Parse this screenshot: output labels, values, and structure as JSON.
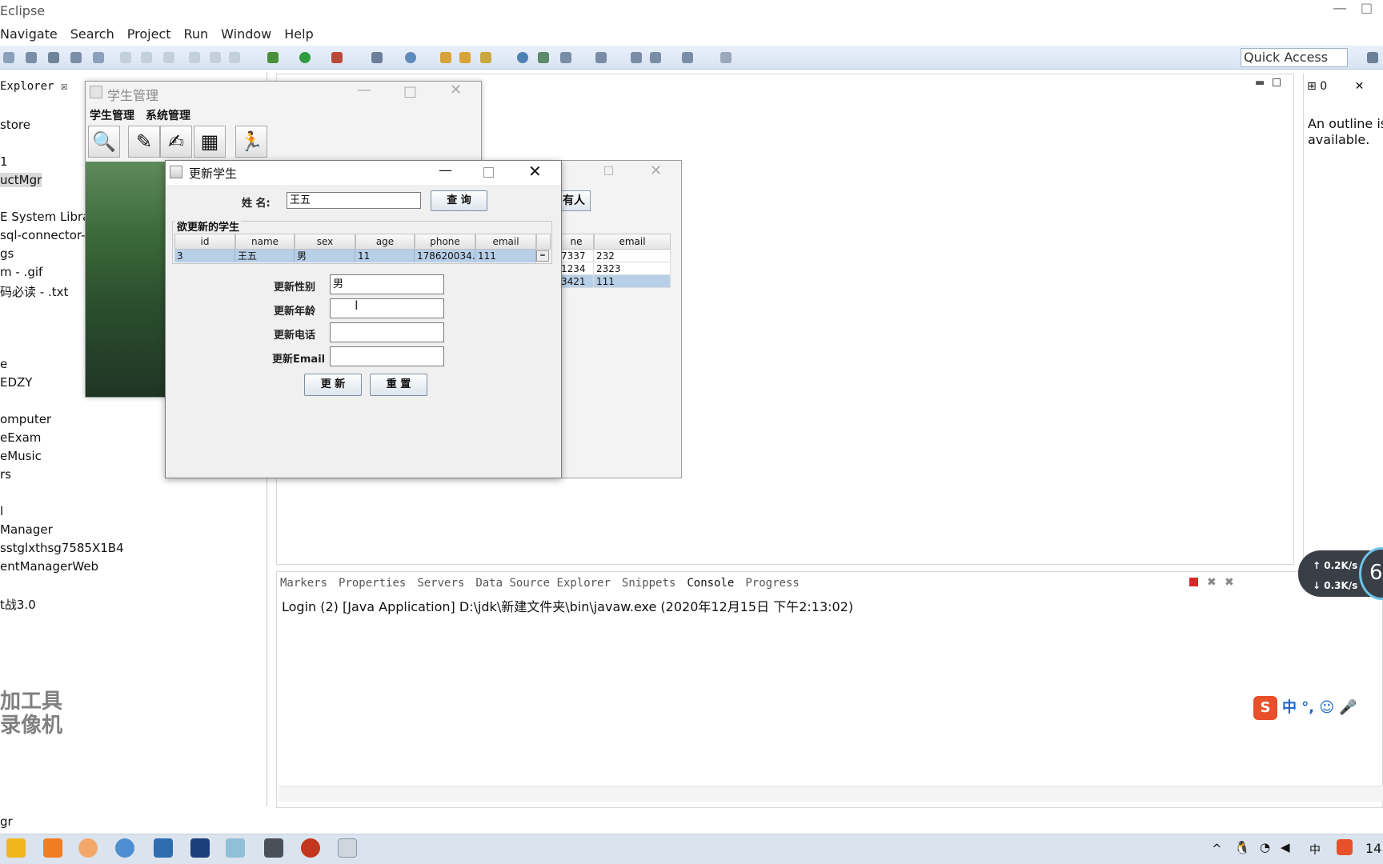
{
  "eclipse": {
    "title": "Eclipse",
    "menus": [
      "Navigate",
      "Search",
      "Project",
      "Run",
      "Window",
      "Help"
    ],
    "quick_access": "Quick Access",
    "explorer_tab": "Explorer",
    "tree_items": [
      "store",
      "1",
      "uctMgr",
      "E System Librar",
      "sql-connector-",
      "gs",
      "m - .gif",
      "码必读 - .txt",
      "e",
      "EDZY",
      "omputer",
      "eExam",
      "eMusic",
      "rs",
      "l",
      "Manager",
      "sstglxthsg7585X1B4",
      "entManagerWeb",
      "t战3.0"
    ],
    "watermark": "加工具 录像机",
    "status_left": "gr",
    "outline_tab": "0",
    "outline_msg": "An outline is available.",
    "console_tabs": [
      "Markers",
      "Properties",
      "Servers",
      "Data Source Explorer",
      "Snippets",
      "Console",
      "Progress"
    ],
    "console_line": "Login (2) [Java Application] D:\\jdk\\新建文件夹\\bin\\javaw.exe (2020年12月15日 下午2:13:02)",
    "speed_up": "0.2K/s",
    "speed_down": "0.3K/s",
    "speed_ring": "6",
    "ime": "中 °, ☺ 🎤",
    "clock": "14"
  },
  "main_frame": {
    "title": "学生管理",
    "menus": [
      "学生管理",
      "系统管理"
    ]
  },
  "list_frame": {
    "button_fragment": "有人",
    "headers": [
      "ne",
      "email"
    ],
    "rows": [
      [
        "7337",
        "232"
      ],
      [
        "1234",
        "2323"
      ],
      [
        "3421",
        "111"
      ]
    ]
  },
  "dialog": {
    "title": "更新学生",
    "search_label": "姓 名:",
    "search_value": "王五",
    "query_button": "查 询",
    "group_title": "欲更新的学生",
    "columns": [
      "id",
      "name",
      "sex",
      "age",
      "phone",
      "email"
    ],
    "row": [
      "3",
      "王五",
      "男",
      "11",
      "178620034...",
      "111"
    ],
    "fields": [
      {
        "label": "更新性别",
        "value": "男"
      },
      {
        "label": "更新年龄",
        "value": ""
      },
      {
        "label": "更新电话",
        "value": ""
      },
      {
        "label": "更新Email",
        "value": ""
      }
    ],
    "update_button": "更 新",
    "reset_button": "重 置"
  }
}
